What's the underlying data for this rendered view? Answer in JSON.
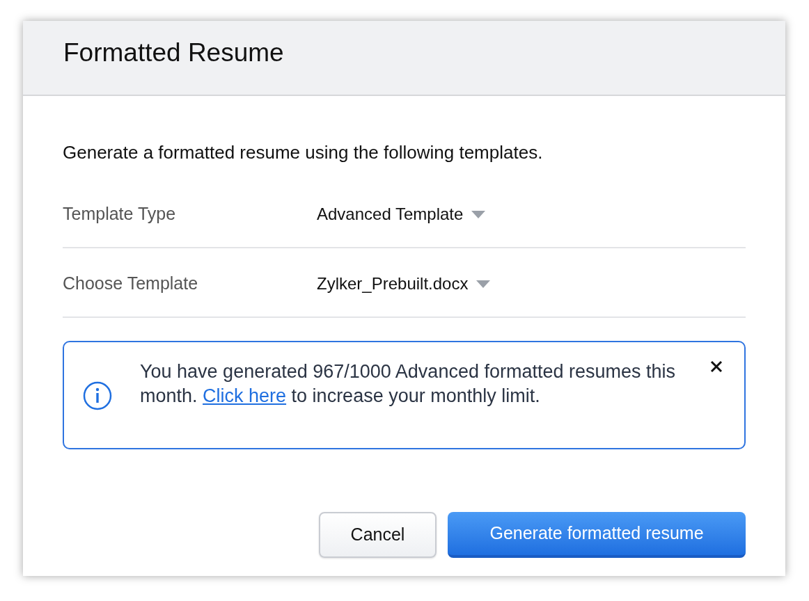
{
  "dialog": {
    "title": "Formatted Resume"
  },
  "intro": "Generate a formatted resume using the following templates.",
  "fields": [
    {
      "label": "Template Type",
      "value": "Advanced Template"
    },
    {
      "label": "Choose Template",
      "value": "Zylker_Prebuilt.docx"
    }
  ],
  "notice": {
    "text_before": "You have generated 967/1000 Advanced formatted resumes this month. ",
    "link": "Click here",
    "text_after": " to increase your monthly limit."
  },
  "buttons": [
    {
      "label": "Cancel",
      "kind": "secondary"
    },
    {
      "label": "Generate formatted resume",
      "kind": "primary"
    }
  ]
}
